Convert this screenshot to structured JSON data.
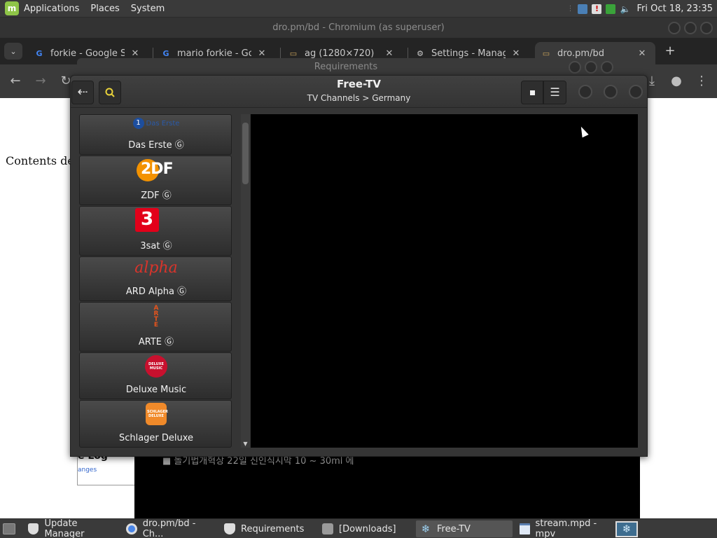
{
  "top_panel": {
    "menus": [
      "Applications",
      "Places",
      "System"
    ],
    "clock": "Fri Oct 18, 23:35"
  },
  "chromium": {
    "window_title": "dro.pm/bd - Chromium (as superuser)",
    "tabs": [
      {
        "title": "forkie - Google Se",
        "favicon": "google-icon"
      },
      {
        "title": "mario forkie - Goo",
        "favicon": "google-icon"
      },
      {
        "title": "ag (1280×720)",
        "favicon": "folder-icon"
      },
      {
        "title": "Settings - Manage",
        "favicon": "gear-icon"
      },
      {
        "title": "dro.pm/bd",
        "favicon": "folder-icon"
      }
    ],
    "page_text": "Contents dete",
    "page_box_title": "e Log",
    "page_box_link": "anges"
  },
  "mpv": {
    "overlay_text": "■ 돌기법개혁상          22일  신인식시막  10 ~ 30ml 에"
  },
  "requirements_window": {
    "title": "Requirements"
  },
  "freetv": {
    "title": "Free-TV",
    "breadcrumb": "TV Channels > Germany",
    "channels": [
      {
        "name": "Das Erste Ⓖ",
        "logo": "das-erste-logo",
        "logo_text": "Das Erste"
      },
      {
        "name": "ZDF Ⓖ",
        "logo": "zdf-logo",
        "logo_text": "2DF"
      },
      {
        "name": "3sat Ⓖ",
        "logo": "3sat-logo",
        "logo_text": "3"
      },
      {
        "name": "ARD Alpha Ⓖ",
        "logo": "alpha-logo",
        "logo_text": "alpha"
      },
      {
        "name": "ARTE Ⓖ",
        "logo": "arte-logo",
        "logo_text": "ARTE"
      },
      {
        "name": "Deluxe Music",
        "logo": "deluxe-music-logo",
        "logo_text": "DELUXE MUSIC"
      },
      {
        "name": "Schlager Deluxe",
        "logo": "schlager-deluxe-logo",
        "logo_text": "SCHLAGER DELUXE"
      }
    ]
  },
  "taskbar": {
    "tasks": [
      {
        "label": "Update Manager",
        "icon": "shield-icon"
      },
      {
        "label": "dro.pm/bd - Ch...",
        "icon": "chromium-icon"
      },
      {
        "label": "Requirements",
        "icon": "shield-icon"
      },
      {
        "label": "[Downloads]",
        "icon": "folder-icon"
      },
      {
        "label": "Free-TV",
        "icon": "snowflake-icon"
      },
      {
        "label": "stream.mpd - mpv",
        "icon": "window-icon"
      }
    ]
  },
  "colors": {
    "panel": "#3a3a3a",
    "mint_green": "#8fc548",
    "zdf_orange": "#f39200",
    "threesat_red": "#e2001a",
    "alpha_red": "#d9342b"
  }
}
